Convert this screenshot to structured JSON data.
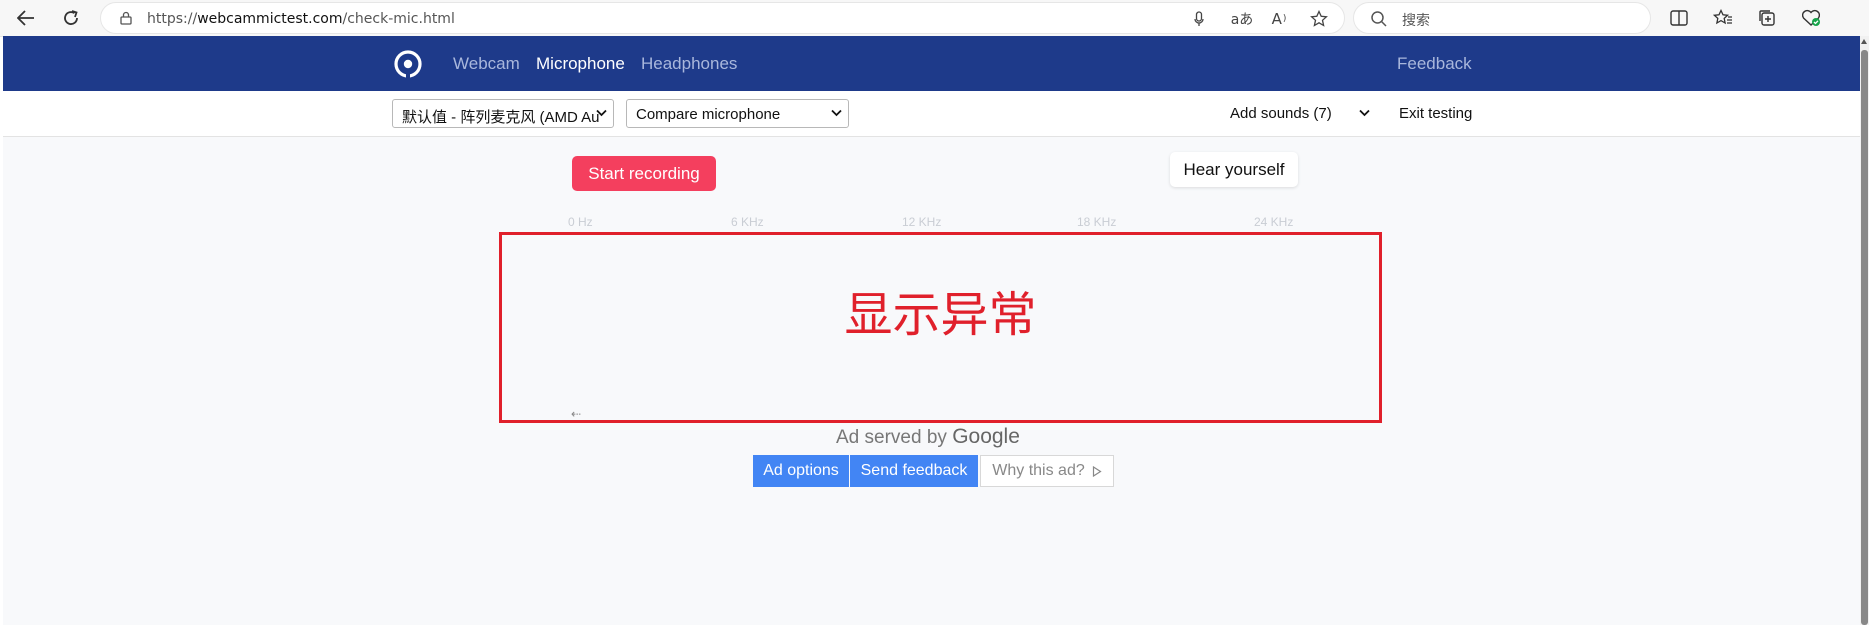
{
  "browser": {
    "url_prefix": "https://",
    "url_host": "webcammictest.com",
    "url_path": "/check-mic.html",
    "search_placeholder": "搜索",
    "translate_glyph": "aあ",
    "read_aloud_glyph": "A"
  },
  "site": {
    "nav": [
      {
        "label": "Webcam"
      },
      {
        "label": "Microphone"
      },
      {
        "label": "Headphones"
      }
    ],
    "feedback_label": "Feedback",
    "colors": {
      "header": "#1e3a8a",
      "record": "#f43f5e",
      "annotation": "#e0202b",
      "ad_button": "#4285f4"
    }
  },
  "toolbar": {
    "device_select": "默认值 - 阵列麦克风 (AMD Au",
    "compare_select": "Compare microphone",
    "add_sounds": "Add sounds (7)",
    "exit_testing": "Exit testing"
  },
  "main": {
    "start_recording": "Start recording",
    "hear_yourself": "Hear yourself",
    "freq_labels": [
      "0 Hz",
      "6 KHz",
      "12 KHz",
      "18 KHz",
      "24 KHz"
    ],
    "annotation_text": "显示异常"
  },
  "ad": {
    "served_by": "Ad served by",
    "google": "Google",
    "options": "Ad options",
    "feedback": "Send feedback",
    "why": "Why this ad?"
  }
}
